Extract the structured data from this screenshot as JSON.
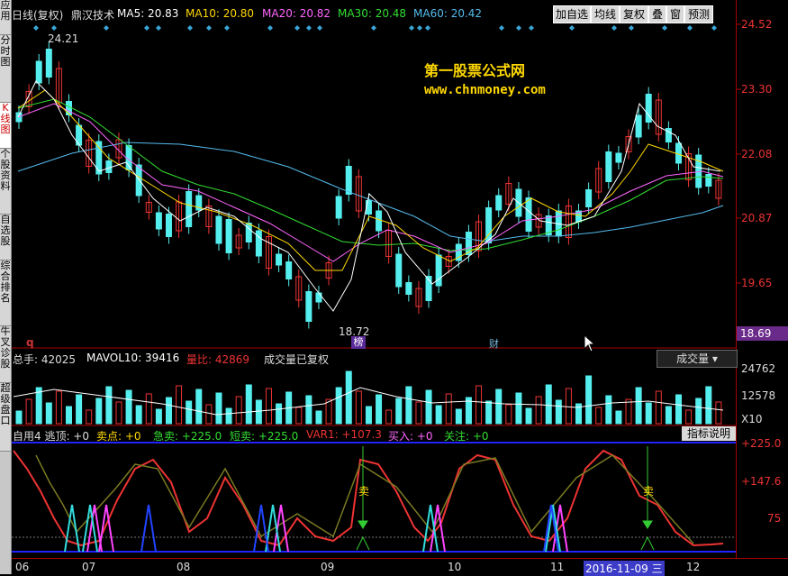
{
  "sidebar": {
    "tabs": [
      {
        "label": "应用"
      },
      {
        "label": "分时图"
      },
      {
        "label": "K线图"
      },
      {
        "label": "个股资料"
      },
      {
        "label": "自选股"
      },
      {
        "label": "综合排名"
      },
      {
        "label": "牛叉诊股"
      },
      {
        "label": "超级盘口"
      }
    ]
  },
  "header": {
    "period": "日线(复权)",
    "stock_name": "鼎汉技术",
    "ma5": "MA5: 20.83",
    "ma10": "MA10: 20.80",
    "ma20": "MA20: 20.82",
    "ma30": "MA30: 20.48",
    "ma60": "MA60: 20.42",
    "buttons": [
      "加自选",
      "均线",
      "复权",
      "叠",
      "窗",
      "预测"
    ],
    "colors": {
      "ma5": "#ffffff",
      "ma10": "#ffd800",
      "ma20": "#ff66ff",
      "ma30": "#33dd33",
      "ma60": "#55bbee"
    }
  },
  "price_chart": {
    "axis_labels": [
      "24.52",
      "23.30",
      "22.08",
      "20.87",
      "19.65",
      "18.69"
    ],
    "high_label": "24.21",
    "low_label": "18.72",
    "marker_bang": "榜",
    "marker_cai": "财",
    "marker_q": "q"
  },
  "watermark": {
    "line1": "第一股票公式网",
    "line2": "www.chnmoney.com"
  },
  "volume_panel": {
    "total": "总手: 42025",
    "mavol": "MAVOL10: 39416",
    "ratio": "量比: 42869",
    "note": "成交量已复权",
    "dropdown": "成交量",
    "axis_labels": [
      "24762",
      "12578",
      "X10"
    ]
  },
  "indicator_panel": {
    "name": "自用4 逃顶: +0",
    "sell_point": "卖点: +0",
    "urgent_sell": "急卖: +225.0",
    "short_sell": "短卖: +225.0",
    "var1": "VAR1: +107.3",
    "buy_in": "买入: +0",
    "watch": "关注: +0",
    "help_button": "指标说明",
    "axis_labels": [
      "+225.0",
      "+147.6",
      "75"
    ],
    "sell_marker": "卖"
  },
  "date_axis": {
    "labels": [
      "06",
      "07",
      "08",
      "09",
      "10",
      "11",
      "12"
    ],
    "cursor_date": "2016-11-09",
    "cursor_weekday": "三"
  }
}
